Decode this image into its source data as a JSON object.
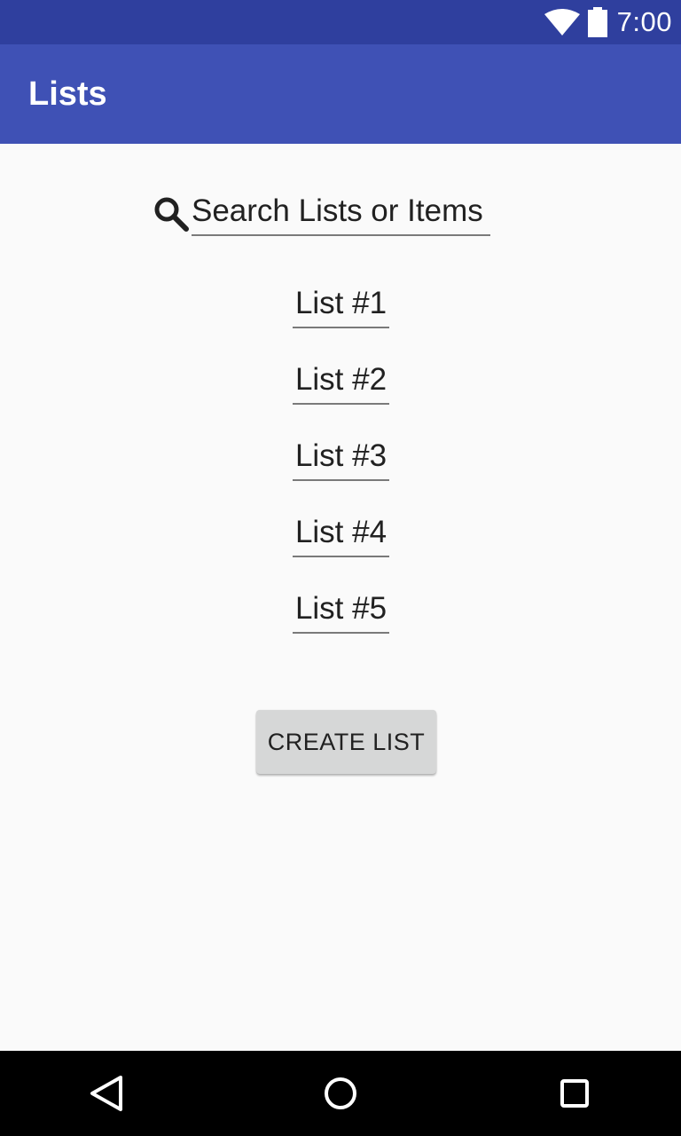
{
  "status_bar": {
    "time": "7:00",
    "icons": [
      "wifi-icon",
      "battery-icon"
    ],
    "color": "#2f3f9e"
  },
  "app_bar": {
    "title": "Lists",
    "color": "#3f51b5"
  },
  "search": {
    "icon": "search-icon",
    "placeholder": "Search Lists or Items"
  },
  "lists": [
    {
      "label": "List #1"
    },
    {
      "label": "List #2"
    },
    {
      "label": "List #3"
    },
    {
      "label": "List #4"
    },
    {
      "label": "List #5"
    }
  ],
  "create_button": {
    "label": "CREATE LIST"
  },
  "nav_bar": {
    "buttons": [
      "back-icon",
      "home-icon",
      "recent-apps-icon"
    ]
  }
}
